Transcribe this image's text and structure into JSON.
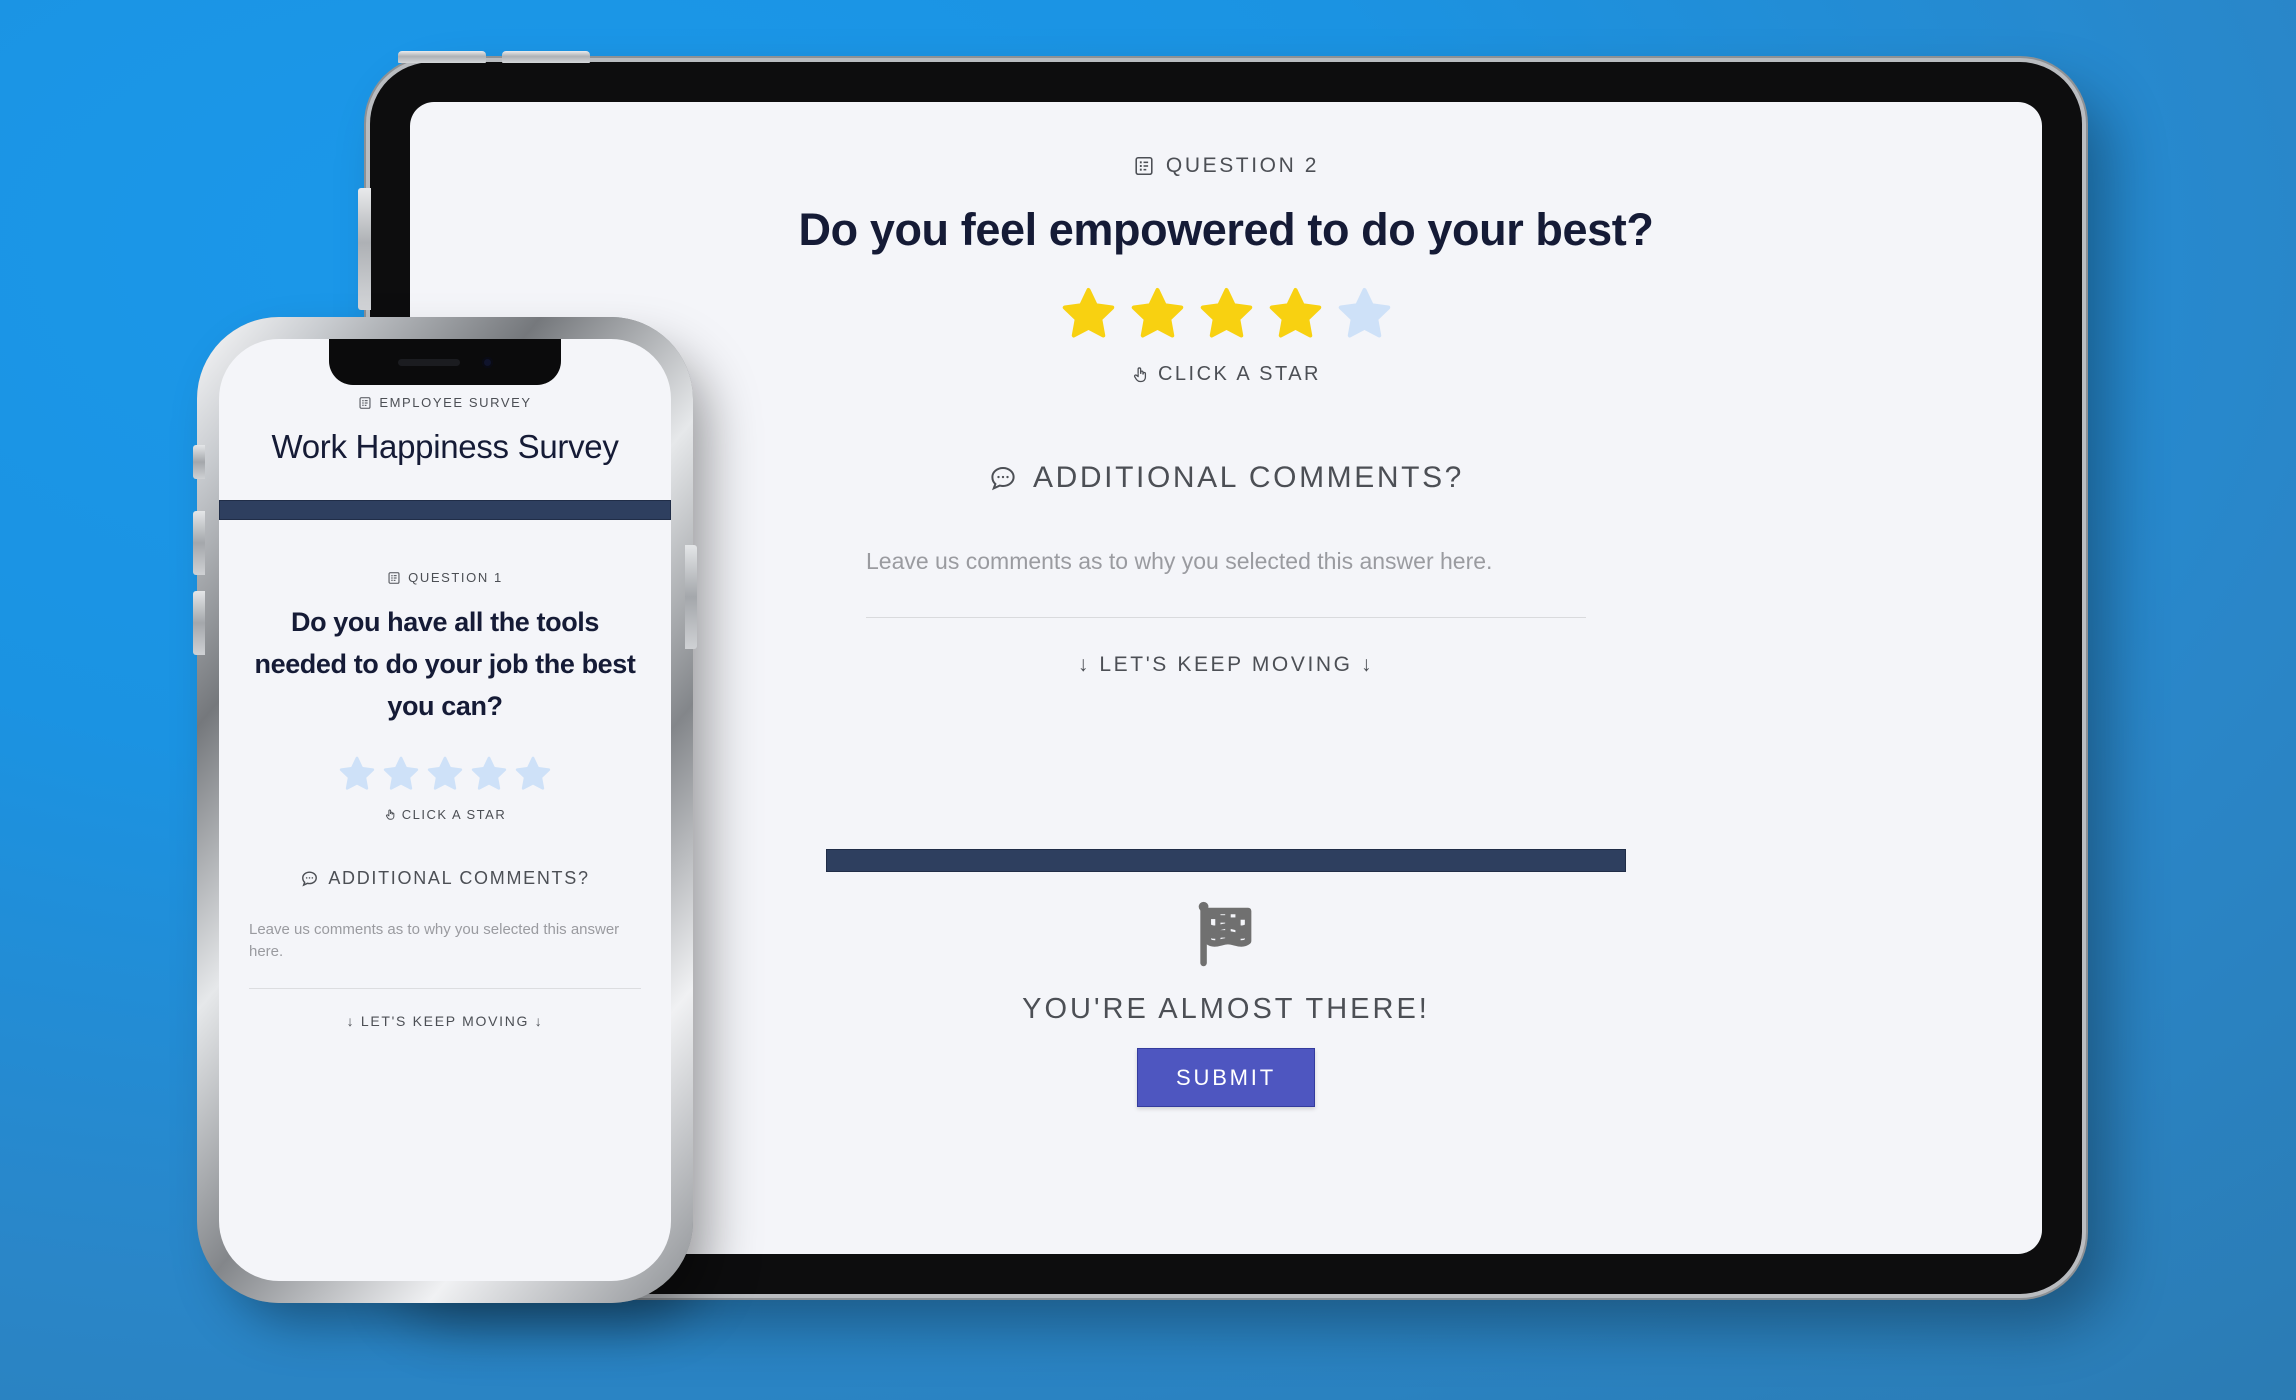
{
  "colors": {
    "background_blue": "#1b93e2",
    "screen_bg": "#f4f5f9",
    "navy_bar": "#2e3f5f",
    "heading_navy": "#151b36",
    "label_gray": "#4c4f55",
    "placeholder_gray": "#9a9ba0",
    "star_filled": "#f8d111",
    "star_empty": "#cee1f8",
    "submit_bg": "#4e56c0",
    "submit_text": "#ffffff",
    "flag_gray": "#707070"
  },
  "tablet": {
    "device": "tablet-device",
    "survey": {
      "question_eyebrow": "QUESTION 2",
      "question_eyebrow_icon": "form-icon",
      "question_title": "Do you feel empowered to do your best?",
      "rating": {
        "value": 4,
        "max": 5,
        "icon": "star-icon"
      },
      "click_star_label": "CLICK A STAR",
      "click_star_icon": "pointing-hand-icon",
      "comments_heading": "ADDITIONAL COMMENTS?",
      "comments_icon": "speech-bubble-icon",
      "comments_placeholder": "Leave us comments as to why you selected this answer here.",
      "comments_value": "",
      "keep_moving_label": "↓ LET'S KEEP MOVING ↓",
      "almost_there_label": "YOU'RE ALMOST THERE!",
      "finish_icon": "checkered-flag-icon",
      "submit_label": "SUBMIT"
    }
  },
  "phone": {
    "device": "phone-device",
    "survey": {
      "brand_eyebrow": "EMPLOYEE SURVEY",
      "brand_eyebrow_icon": "form-icon",
      "survey_title": "Work Happiness Survey",
      "question_eyebrow": "QUESTION 1",
      "question_eyebrow_icon": "form-icon",
      "question_title": "Do you have all the tools needed to do your job the best you can?",
      "rating": {
        "value": 0,
        "max": 5,
        "icon": "star-icon"
      },
      "click_star_label": "CLICK A STAR",
      "click_star_icon": "pointing-hand-icon",
      "comments_heading": "ADDITIONAL COMMENTS?",
      "comments_icon": "speech-bubble-icon",
      "comments_placeholder": "Leave us comments as to why you selected this answer here.",
      "comments_value": "",
      "keep_moving_label": "↓ LET'S KEEP MOVING ↓"
    }
  }
}
